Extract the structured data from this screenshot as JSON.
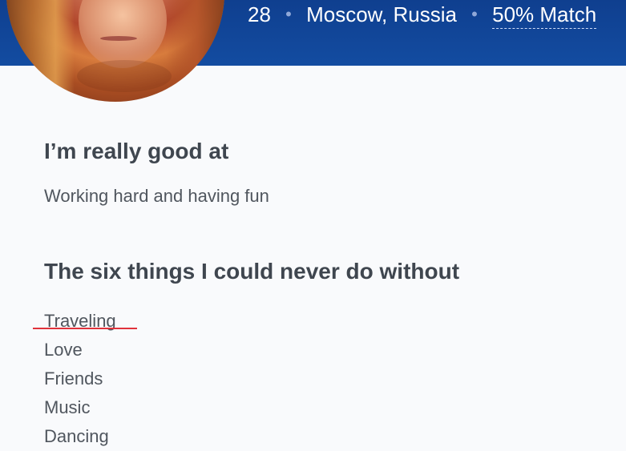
{
  "profile": {
    "age": "28",
    "location": "Moscow, Russia",
    "match": "50% Match",
    "separator": "•"
  },
  "sections": {
    "good_at": {
      "title": "I’m really good at",
      "text": "Working hard and having fun"
    },
    "six_things": {
      "title": "The six things I could never do without",
      "items": [
        "Traveling",
        "Love",
        "Friends",
        "Music",
        "Dancing"
      ]
    }
  },
  "colors": {
    "header_blue": "#134ca1",
    "underline_red": "#e0323b",
    "text_gray": "#50565e"
  }
}
